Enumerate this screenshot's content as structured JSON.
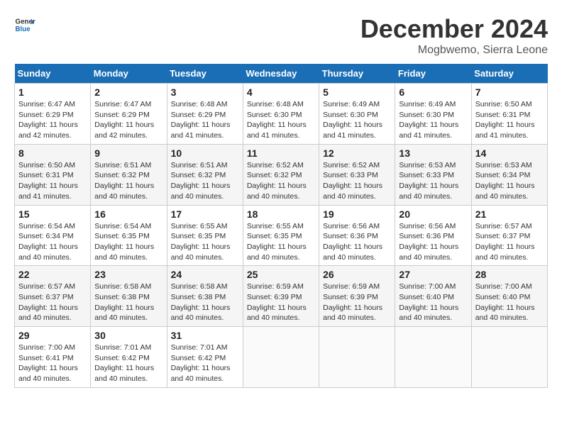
{
  "header": {
    "logo_line1": "General",
    "logo_line2": "Blue",
    "month": "December 2024",
    "location": "Mogbwemo, Sierra Leone"
  },
  "days_of_week": [
    "Sunday",
    "Monday",
    "Tuesday",
    "Wednesday",
    "Thursday",
    "Friday",
    "Saturday"
  ],
  "weeks": [
    [
      {
        "day": "1",
        "info": "Sunrise: 6:47 AM\nSunset: 6:29 PM\nDaylight: 11 hours\nand 42 minutes."
      },
      {
        "day": "2",
        "info": "Sunrise: 6:47 AM\nSunset: 6:29 PM\nDaylight: 11 hours\nand 42 minutes."
      },
      {
        "day": "3",
        "info": "Sunrise: 6:48 AM\nSunset: 6:29 PM\nDaylight: 11 hours\nand 41 minutes."
      },
      {
        "day": "4",
        "info": "Sunrise: 6:48 AM\nSunset: 6:30 PM\nDaylight: 11 hours\nand 41 minutes."
      },
      {
        "day": "5",
        "info": "Sunrise: 6:49 AM\nSunset: 6:30 PM\nDaylight: 11 hours\nand 41 minutes."
      },
      {
        "day": "6",
        "info": "Sunrise: 6:49 AM\nSunset: 6:30 PM\nDaylight: 11 hours\nand 41 minutes."
      },
      {
        "day": "7",
        "info": "Sunrise: 6:50 AM\nSunset: 6:31 PM\nDaylight: 11 hours\nand 41 minutes."
      }
    ],
    [
      {
        "day": "8",
        "info": "Sunrise: 6:50 AM\nSunset: 6:31 PM\nDaylight: 11 hours\nand 41 minutes."
      },
      {
        "day": "9",
        "info": "Sunrise: 6:51 AM\nSunset: 6:32 PM\nDaylight: 11 hours\nand 40 minutes."
      },
      {
        "day": "10",
        "info": "Sunrise: 6:51 AM\nSunset: 6:32 PM\nDaylight: 11 hours\nand 40 minutes."
      },
      {
        "day": "11",
        "info": "Sunrise: 6:52 AM\nSunset: 6:32 PM\nDaylight: 11 hours\nand 40 minutes."
      },
      {
        "day": "12",
        "info": "Sunrise: 6:52 AM\nSunset: 6:33 PM\nDaylight: 11 hours\nand 40 minutes."
      },
      {
        "day": "13",
        "info": "Sunrise: 6:53 AM\nSunset: 6:33 PM\nDaylight: 11 hours\nand 40 minutes."
      },
      {
        "day": "14",
        "info": "Sunrise: 6:53 AM\nSunset: 6:34 PM\nDaylight: 11 hours\nand 40 minutes."
      }
    ],
    [
      {
        "day": "15",
        "info": "Sunrise: 6:54 AM\nSunset: 6:34 PM\nDaylight: 11 hours\nand 40 minutes."
      },
      {
        "day": "16",
        "info": "Sunrise: 6:54 AM\nSunset: 6:35 PM\nDaylight: 11 hours\nand 40 minutes."
      },
      {
        "day": "17",
        "info": "Sunrise: 6:55 AM\nSunset: 6:35 PM\nDaylight: 11 hours\nand 40 minutes."
      },
      {
        "day": "18",
        "info": "Sunrise: 6:55 AM\nSunset: 6:35 PM\nDaylight: 11 hours\nand 40 minutes."
      },
      {
        "day": "19",
        "info": "Sunrise: 6:56 AM\nSunset: 6:36 PM\nDaylight: 11 hours\nand 40 minutes."
      },
      {
        "day": "20",
        "info": "Sunrise: 6:56 AM\nSunset: 6:36 PM\nDaylight: 11 hours\nand 40 minutes."
      },
      {
        "day": "21",
        "info": "Sunrise: 6:57 AM\nSunset: 6:37 PM\nDaylight: 11 hours\nand 40 minutes."
      }
    ],
    [
      {
        "day": "22",
        "info": "Sunrise: 6:57 AM\nSunset: 6:37 PM\nDaylight: 11 hours\nand 40 minutes."
      },
      {
        "day": "23",
        "info": "Sunrise: 6:58 AM\nSunset: 6:38 PM\nDaylight: 11 hours\nand 40 minutes."
      },
      {
        "day": "24",
        "info": "Sunrise: 6:58 AM\nSunset: 6:38 PM\nDaylight: 11 hours\nand 40 minutes."
      },
      {
        "day": "25",
        "info": "Sunrise: 6:59 AM\nSunset: 6:39 PM\nDaylight: 11 hours\nand 40 minutes."
      },
      {
        "day": "26",
        "info": "Sunrise: 6:59 AM\nSunset: 6:39 PM\nDaylight: 11 hours\nand 40 minutes."
      },
      {
        "day": "27",
        "info": "Sunrise: 7:00 AM\nSunset: 6:40 PM\nDaylight: 11 hours\nand 40 minutes."
      },
      {
        "day": "28",
        "info": "Sunrise: 7:00 AM\nSunset: 6:40 PM\nDaylight: 11 hours\nand 40 minutes."
      }
    ],
    [
      {
        "day": "29",
        "info": "Sunrise: 7:00 AM\nSunset: 6:41 PM\nDaylight: 11 hours\nand 40 minutes."
      },
      {
        "day": "30",
        "info": "Sunrise: 7:01 AM\nSunset: 6:42 PM\nDaylight: 11 hours\nand 40 minutes."
      },
      {
        "day": "31",
        "info": "Sunrise: 7:01 AM\nSunset: 6:42 PM\nDaylight: 11 hours\nand 40 minutes."
      },
      null,
      null,
      null,
      null
    ]
  ]
}
